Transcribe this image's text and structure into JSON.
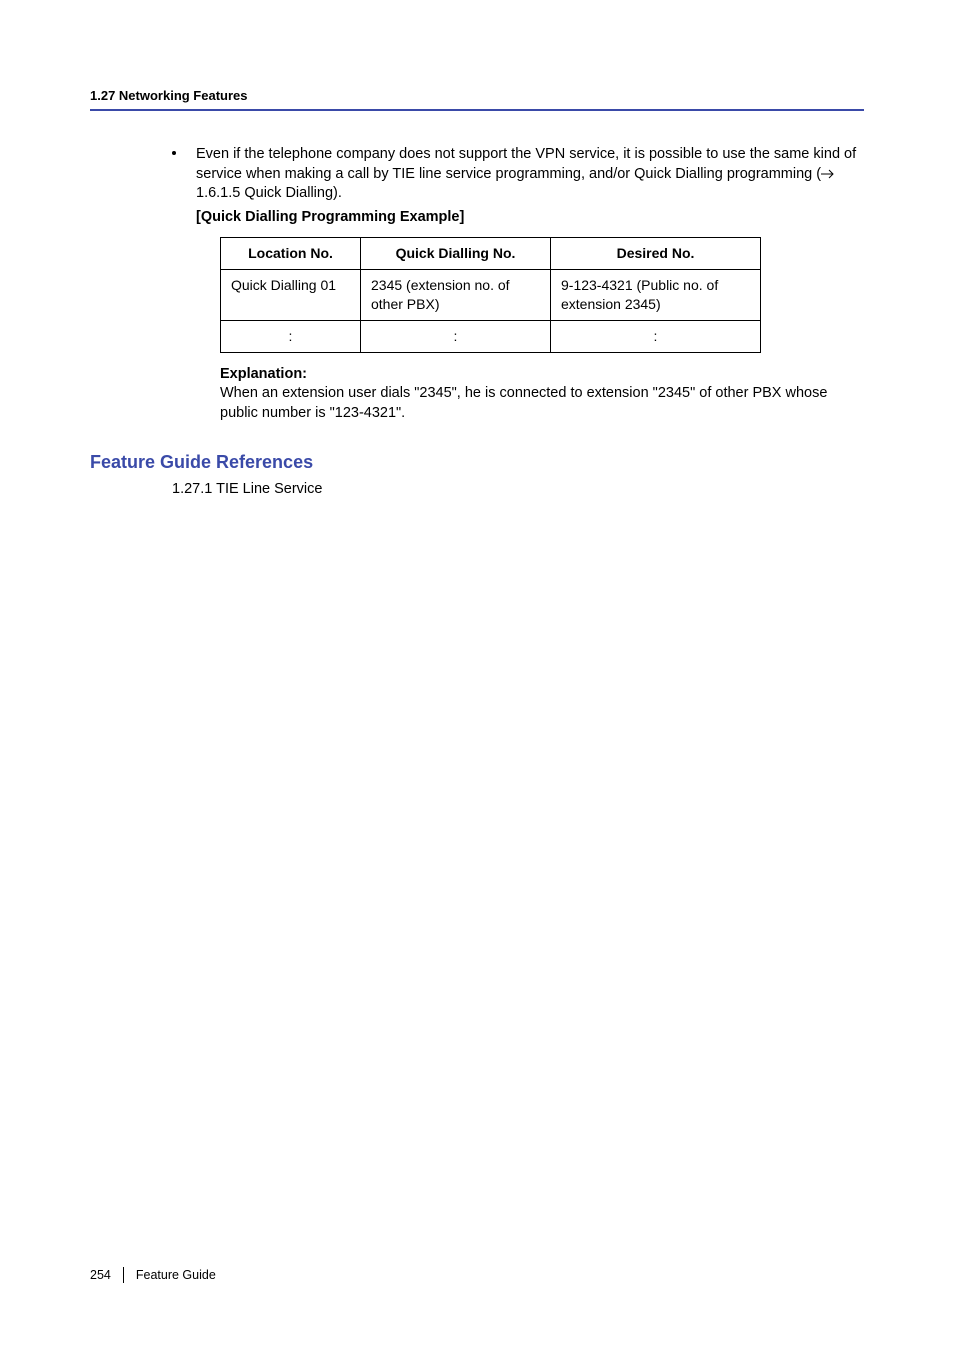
{
  "header": {
    "running_head": "1.27 Networking Features"
  },
  "bullet": {
    "text_line1": "Even if the telephone company does not support the VPN service, it is possible to use the same kind of service when making a call by TIE line service programming, and/or Quick Dialling programming (",
    "ref": " 1.6.1.5 Quick Dialling).",
    "subhead": "[Quick Dialling Programming Example]"
  },
  "table": {
    "headers": {
      "location": "Location No.",
      "quick": "Quick Dialling No.",
      "desired": "Desired No."
    },
    "rows": [
      {
        "location": "Quick Dialling 01",
        "quick": "2345 (extension no. of other PBX)",
        "desired": "9-123-4321 (Public no. of extension 2345)"
      },
      {
        "location": ":",
        "quick": ":",
        "desired": ":"
      }
    ]
  },
  "explanation": {
    "head": "Explanation:",
    "body": "When an extension user dials \"2345\", he is connected to extension \"2345\" of other PBX whose public number is \"123-4321\"."
  },
  "references": {
    "title": "Feature Guide References",
    "items": [
      "1.27.1 TIE Line Service"
    ]
  },
  "footer": {
    "page": "254",
    "label": "Feature Guide"
  }
}
